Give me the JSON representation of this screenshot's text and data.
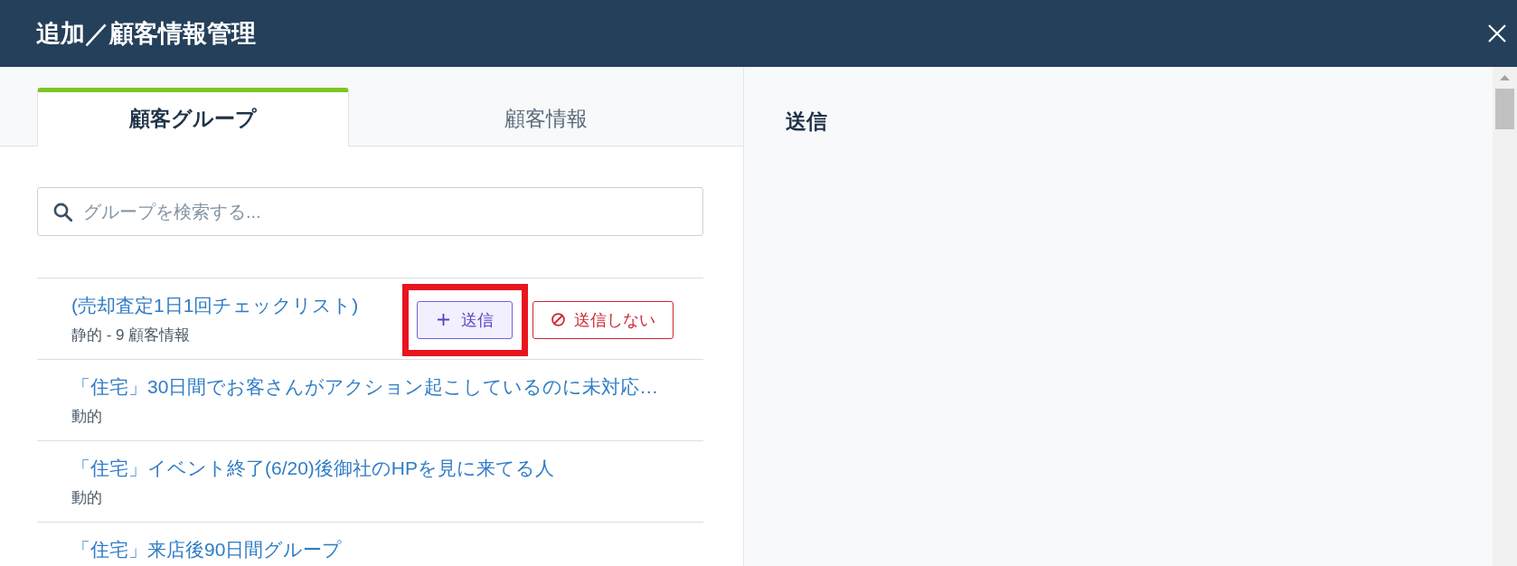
{
  "header": {
    "title": "追加／顧客情報管理"
  },
  "tabs": [
    {
      "label": "顧客グループ",
      "selected": true
    },
    {
      "label": "顧客情報",
      "selected": false
    }
  ],
  "search": {
    "placeholder": "グループを検索する..."
  },
  "groups": [
    {
      "name": "(売却査定1日1回チェックリスト)",
      "meta": "静的 - 9 顧客情報",
      "actions": [
        {
          "kind": "add",
          "label": "送信",
          "highlighted": true
        },
        {
          "kind": "exclude",
          "label": "送信しない",
          "highlighted": false
        }
      ]
    },
    {
      "name": "「住宅」30日間でお客さんがアクション起こしているのに未対応…",
      "meta": "動的"
    },
    {
      "name": "「住宅」イベント終了(6/20)後御社のHPを見に来てる人",
      "meta": "動的"
    },
    {
      "name": "「住宅」来店後90日間グループ"
    }
  ],
  "send_panel": {
    "title": "送信"
  }
}
